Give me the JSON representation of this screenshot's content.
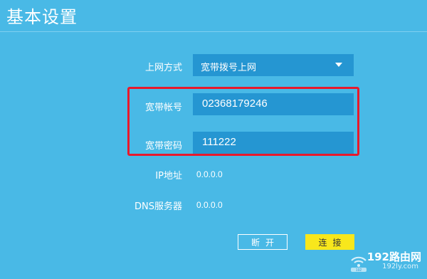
{
  "page": {
    "title": "基本设置"
  },
  "form": {
    "connection_type": {
      "label": "上网方式",
      "value": "宽带拨号上网"
    },
    "account": {
      "label": "宽带帐号",
      "value": "02368179246"
    },
    "password": {
      "label": "宽带密码",
      "value": "111222"
    },
    "ip_address": {
      "label": "IP地址",
      "value": "0.0.0.0"
    },
    "dns_server": {
      "label": "DNS服务器",
      "value": "0.0.0.0"
    }
  },
  "buttons": {
    "disconnect": "断开",
    "connect": "连接"
  },
  "watermark": {
    "main": "192路由网",
    "sub": "192ly.com",
    "badge": "192"
  },
  "colors": {
    "background": "#49b9e6",
    "field": "#2596d2",
    "highlight": "#e8192c",
    "connect_button": "#f8e71c"
  }
}
